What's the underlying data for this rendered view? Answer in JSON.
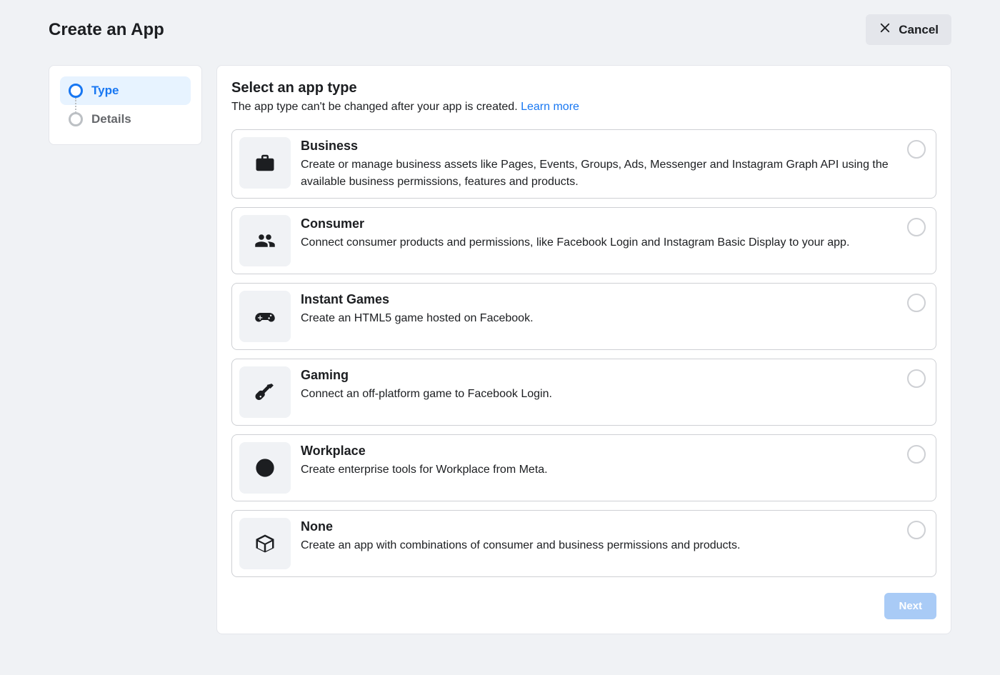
{
  "header": {
    "title": "Create an App",
    "cancel_label": "Cancel"
  },
  "sidebar": {
    "steps": [
      {
        "label": "Type",
        "active": true
      },
      {
        "label": "Details",
        "active": false
      }
    ]
  },
  "main": {
    "heading": "Select an app type",
    "subtext": "The app type can't be changed after your app is created. ",
    "learn_more": "Learn more",
    "options": [
      {
        "icon": "briefcase-icon",
        "title": "Business",
        "desc": "Create or manage business assets like Pages, Events, Groups, Ads, Messenger and Instagram Graph API using the available business permissions, features and products."
      },
      {
        "icon": "users-icon",
        "title": "Consumer",
        "desc": "Connect consumer products and permissions, like Facebook Login and Instagram Basic Display to your app."
      },
      {
        "icon": "gamepad-icon",
        "title": "Instant Games",
        "desc": "Create an HTML5 game hosted on Facebook."
      },
      {
        "icon": "guitar-icon",
        "title": "Gaming",
        "desc": "Connect an off-platform game to Facebook Login."
      },
      {
        "icon": "workplace-icon",
        "title": "Workplace",
        "desc": "Create enterprise tools for Workplace from Meta."
      },
      {
        "icon": "cube-icon",
        "title": "None",
        "desc": "Create an app with combinations of consumer and business permissions and products."
      }
    ],
    "next_label": "Next"
  }
}
